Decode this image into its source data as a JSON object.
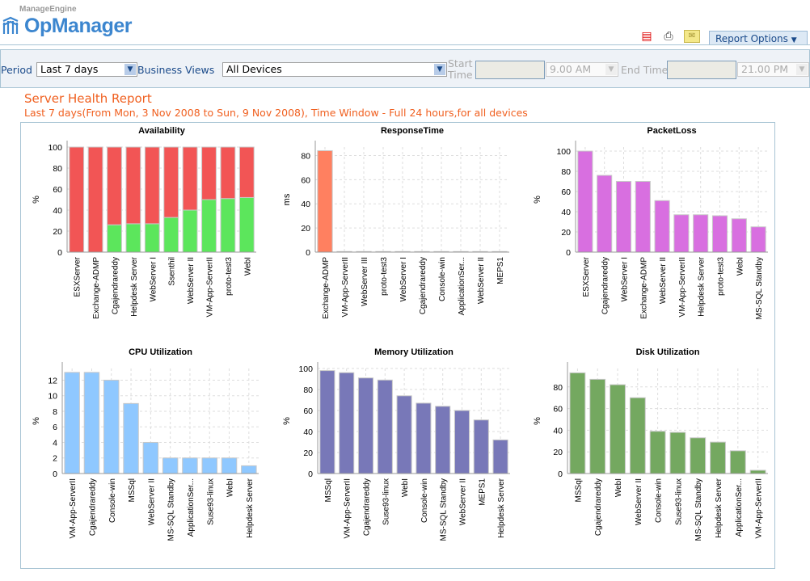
{
  "header": {
    "vendor": "ManageEngine",
    "product": "OpManager",
    "report_options_label": "Report Options",
    "icons": [
      "pdf-icon",
      "print-icon",
      "email-icon"
    ]
  },
  "filters": {
    "period_label": "Period",
    "period_value": "Last 7 days",
    "business_views_label": "Business Views",
    "business_views_value": "All Devices",
    "start_time_label": "Start Time",
    "start_time_value": "9.00 AM",
    "end_time_label": "End Time",
    "end_time_value": "21.00 PM"
  },
  "report": {
    "title": "Server Health Report",
    "subtitle": "Last 7 days(From Mon, 3 Nov 2008 to Sun, 9 Nov 2008), Time Window - Full 24 hours,for all devices"
  },
  "chart_data": [
    {
      "type": "bar",
      "stacked": true,
      "title": "Availability",
      "ylabel": "%",
      "ylim": [
        0,
        100
      ],
      "yticks": [
        0,
        20,
        40,
        60,
        80,
        100
      ],
      "grid": true,
      "categories": [
        "ESXServer",
        "Exchange-ADMP",
        "Cgajendrareddy",
        "Helpdesk Server",
        "WebServer I",
        "Ssenthil",
        "WebServer II",
        "VM-App-ServerII",
        "proto-test3",
        "WebI"
      ],
      "series": [
        {
          "values": [
            0,
            0,
            26,
            27,
            27,
            33,
            40,
            50,
            51,
            52
          ],
          "color": "#5ce65c"
        },
        {
          "values": [
            100,
            100,
            74,
            73,
            73,
            67,
            60,
            50,
            49,
            48
          ],
          "color": "#f25555"
        }
      ]
    },
    {
      "type": "bar",
      "title": "ResponseTime",
      "ylabel": "ms",
      "ylim": [
        0,
        87
      ],
      "yticks": [
        0,
        20,
        40,
        60,
        80
      ],
      "grid": true,
      "categories": [
        "Exchange-ADMP",
        "VM-App-ServerII",
        "WebServer III",
        "proto-test3",
        "WebServer I",
        "Cgajendrareddy",
        "Console-win",
        "ApplicationSer...",
        "WebServer II",
        "MEPS1"
      ],
      "series": [
        {
          "values": [
            84,
            0.5,
            0.5,
            0.5,
            0.5,
            0.5,
            0.5,
            0.5,
            0.5,
            0.5
          ],
          "color": "#ff8060"
        }
      ]
    },
    {
      "type": "bar",
      "title": "PacketLoss",
      "ylabel": "%",
      "ylim": [
        0,
        104
      ],
      "yticks": [
        0,
        20,
        40,
        60,
        80,
        100
      ],
      "grid": true,
      "categories": [
        "ESXServer",
        "Cgajendrareddy",
        "WebServer I",
        "Exchange-ADMP",
        "WebServer II",
        "VM-App-ServerII",
        "Helpdesk Server",
        "proto-test3",
        "WebI",
        "MS-SQL Standby"
      ],
      "series": [
        {
          "values": [
            100,
            76,
            70,
            70,
            51,
            37,
            37,
            36,
            33,
            25
          ],
          "color": "#d86fe0"
        }
      ]
    },
    {
      "type": "bar",
      "title": "CPU Utilization",
      "ylabel": "%",
      "ylim": [
        0,
        13.5
      ],
      "yticks": [
        0,
        2,
        4,
        6,
        8,
        10,
        12
      ],
      "grid": true,
      "categories": [
        "VM-App-ServerII",
        "Cgajendrareddy",
        "Console-win",
        "MSSql",
        "WebServer II",
        "MS-SQL Standby",
        "ApplicationSer...",
        "Suse93-linux",
        "WebI",
        "Helpdesk Server"
      ],
      "series": [
        {
          "values": [
            13,
            13,
            12,
            9,
            4,
            2,
            2,
            2,
            2,
            1
          ],
          "color": "#8fc8ff"
        }
      ]
    },
    {
      "type": "bar",
      "title": "Memory Utilization",
      "ylabel": "%",
      "ylim": [
        0,
        100
      ],
      "yticks": [
        0,
        20,
        40,
        60,
        80,
        100
      ],
      "grid": true,
      "categories": [
        "MSSql",
        "VM-App-ServerII",
        "Cgajendrareddy",
        "Suse93-linux",
        "WebI",
        "Console-win",
        "MS-SQL Standby",
        "WebServer II",
        "MEPS1",
        "Helpdesk Server"
      ],
      "series": [
        {
          "values": [
            98,
            96,
            91,
            89,
            74,
            67,
            64,
            60,
            51,
            32
          ],
          "color": "#7878b8"
        }
      ]
    },
    {
      "type": "bar",
      "title": "Disk Utilization",
      "ylabel": "%",
      "ylim": [
        0,
        97
      ],
      "yticks": [
        0,
        20,
        40,
        60,
        80
      ],
      "grid": true,
      "categories": [
        "MSSql",
        "Cgajendrareddy",
        "WebI",
        "WebServer II",
        "Console-win",
        "Suse93-linux",
        "MS-SQL Standby",
        "Helpdesk Server",
        "ApplicationSer...",
        "VM-App-ServerII"
      ],
      "series": [
        {
          "values": [
            93,
            87,
            82,
            70,
            39,
            38,
            33,
            29,
            21,
            3
          ],
          "color": "#74a860"
        }
      ]
    }
  ]
}
